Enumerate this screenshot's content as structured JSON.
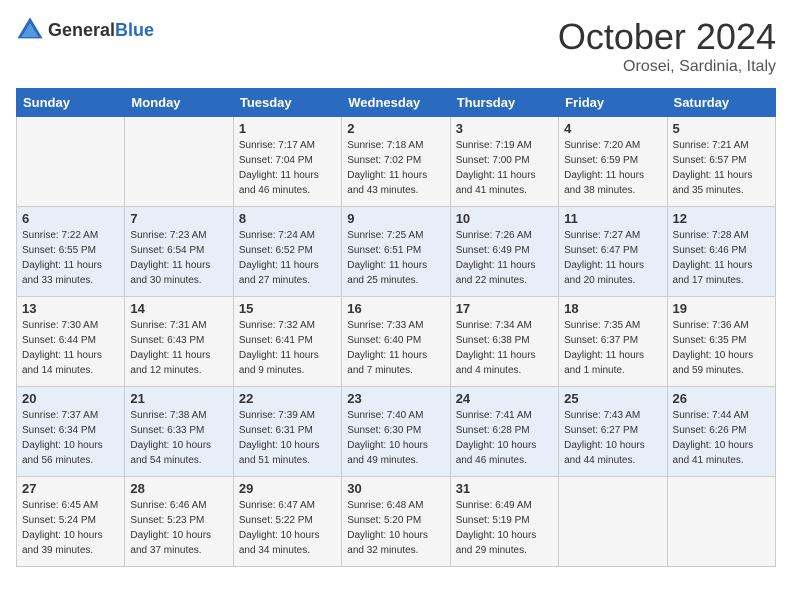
{
  "header": {
    "logo_general": "General",
    "logo_blue": "Blue",
    "month_title": "October 2024",
    "subtitle": "Orosei, Sardinia, Italy"
  },
  "days_of_week": [
    "Sunday",
    "Monday",
    "Tuesday",
    "Wednesday",
    "Thursday",
    "Friday",
    "Saturday"
  ],
  "weeks": [
    [
      {
        "day": "",
        "info": ""
      },
      {
        "day": "",
        "info": ""
      },
      {
        "day": "1",
        "info": "Sunrise: 7:17 AM\nSunset: 7:04 PM\nDaylight: 11 hours and 46 minutes."
      },
      {
        "day": "2",
        "info": "Sunrise: 7:18 AM\nSunset: 7:02 PM\nDaylight: 11 hours and 43 minutes."
      },
      {
        "day": "3",
        "info": "Sunrise: 7:19 AM\nSunset: 7:00 PM\nDaylight: 11 hours and 41 minutes."
      },
      {
        "day": "4",
        "info": "Sunrise: 7:20 AM\nSunset: 6:59 PM\nDaylight: 11 hours and 38 minutes."
      },
      {
        "day": "5",
        "info": "Sunrise: 7:21 AM\nSunset: 6:57 PM\nDaylight: 11 hours and 35 minutes."
      }
    ],
    [
      {
        "day": "6",
        "info": "Sunrise: 7:22 AM\nSunset: 6:55 PM\nDaylight: 11 hours and 33 minutes."
      },
      {
        "day": "7",
        "info": "Sunrise: 7:23 AM\nSunset: 6:54 PM\nDaylight: 11 hours and 30 minutes."
      },
      {
        "day": "8",
        "info": "Sunrise: 7:24 AM\nSunset: 6:52 PM\nDaylight: 11 hours and 27 minutes."
      },
      {
        "day": "9",
        "info": "Sunrise: 7:25 AM\nSunset: 6:51 PM\nDaylight: 11 hours and 25 minutes."
      },
      {
        "day": "10",
        "info": "Sunrise: 7:26 AM\nSunset: 6:49 PM\nDaylight: 11 hours and 22 minutes."
      },
      {
        "day": "11",
        "info": "Sunrise: 7:27 AM\nSunset: 6:47 PM\nDaylight: 11 hours and 20 minutes."
      },
      {
        "day": "12",
        "info": "Sunrise: 7:28 AM\nSunset: 6:46 PM\nDaylight: 11 hours and 17 minutes."
      }
    ],
    [
      {
        "day": "13",
        "info": "Sunrise: 7:30 AM\nSunset: 6:44 PM\nDaylight: 11 hours and 14 minutes."
      },
      {
        "day": "14",
        "info": "Sunrise: 7:31 AM\nSunset: 6:43 PM\nDaylight: 11 hours and 12 minutes."
      },
      {
        "day": "15",
        "info": "Sunrise: 7:32 AM\nSunset: 6:41 PM\nDaylight: 11 hours and 9 minutes."
      },
      {
        "day": "16",
        "info": "Sunrise: 7:33 AM\nSunset: 6:40 PM\nDaylight: 11 hours and 7 minutes."
      },
      {
        "day": "17",
        "info": "Sunrise: 7:34 AM\nSunset: 6:38 PM\nDaylight: 11 hours and 4 minutes."
      },
      {
        "day": "18",
        "info": "Sunrise: 7:35 AM\nSunset: 6:37 PM\nDaylight: 11 hours and 1 minute."
      },
      {
        "day": "19",
        "info": "Sunrise: 7:36 AM\nSunset: 6:35 PM\nDaylight: 10 hours and 59 minutes."
      }
    ],
    [
      {
        "day": "20",
        "info": "Sunrise: 7:37 AM\nSunset: 6:34 PM\nDaylight: 10 hours and 56 minutes."
      },
      {
        "day": "21",
        "info": "Sunrise: 7:38 AM\nSunset: 6:33 PM\nDaylight: 10 hours and 54 minutes."
      },
      {
        "day": "22",
        "info": "Sunrise: 7:39 AM\nSunset: 6:31 PM\nDaylight: 10 hours and 51 minutes."
      },
      {
        "day": "23",
        "info": "Sunrise: 7:40 AM\nSunset: 6:30 PM\nDaylight: 10 hours and 49 minutes."
      },
      {
        "day": "24",
        "info": "Sunrise: 7:41 AM\nSunset: 6:28 PM\nDaylight: 10 hours and 46 minutes."
      },
      {
        "day": "25",
        "info": "Sunrise: 7:43 AM\nSunset: 6:27 PM\nDaylight: 10 hours and 44 minutes."
      },
      {
        "day": "26",
        "info": "Sunrise: 7:44 AM\nSunset: 6:26 PM\nDaylight: 10 hours and 41 minutes."
      }
    ],
    [
      {
        "day": "27",
        "info": "Sunrise: 6:45 AM\nSunset: 5:24 PM\nDaylight: 10 hours and 39 minutes."
      },
      {
        "day": "28",
        "info": "Sunrise: 6:46 AM\nSunset: 5:23 PM\nDaylight: 10 hours and 37 minutes."
      },
      {
        "day": "29",
        "info": "Sunrise: 6:47 AM\nSunset: 5:22 PM\nDaylight: 10 hours and 34 minutes."
      },
      {
        "day": "30",
        "info": "Sunrise: 6:48 AM\nSunset: 5:20 PM\nDaylight: 10 hours and 32 minutes."
      },
      {
        "day": "31",
        "info": "Sunrise: 6:49 AM\nSunset: 5:19 PM\nDaylight: 10 hours and 29 minutes."
      },
      {
        "day": "",
        "info": ""
      },
      {
        "day": "",
        "info": ""
      }
    ]
  ]
}
